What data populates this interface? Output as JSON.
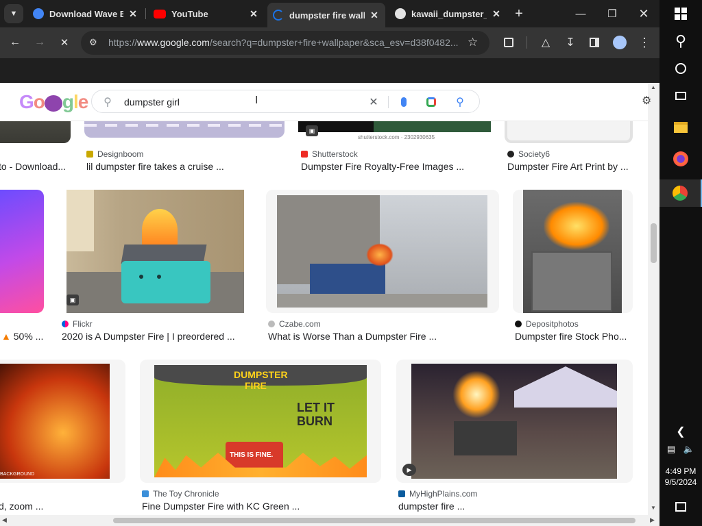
{
  "tabs": [
    {
      "label": "Download Wave Ex",
      "favicon_color": "#4285f4"
    },
    {
      "label": "YouTube",
      "favicon_color": "#ff0000"
    },
    {
      "label": "dumpster fire wallp",
      "favicon_color": "#1a73e8",
      "active": true
    },
    {
      "label": "kawaii_dumpster_fi",
      "favicon_color": "#e3e3e3"
    }
  ],
  "new_tab_label": "+",
  "address_bar": {
    "scheme": "https://",
    "host": "www.google.com",
    "path": "/search?q=dumpster+fire+wallpaper&sca_esv=d38f0482..."
  },
  "search": {
    "query": "dumpster girl",
    "logo": "Google"
  },
  "results": {
    "row1": [
      {
        "source": "",
        "title": "to - Download..."
      },
      {
        "source": "Designboom",
        "title": "lil dumpster fire takes a cruise ..."
      },
      {
        "source": "Shutterstock",
        "title": "Dumpster Fire Royalty-Free Images ...",
        "caption": "shutterstock.com · 2302930635"
      },
      {
        "source": "Society6",
        "title": "Dumpster Fire Art Print by ..."
      }
    ],
    "row2": [
      {
        "source": "",
        "title": "50% ..."
      },
      {
        "source": "Flickr",
        "title": "2020 is A Dumpster Fire | I preordered ..."
      },
      {
        "source": "Czabe.com",
        "title": "What is Worse Than a Dumpster Fire ..."
      },
      {
        "source": "Depositphotos",
        "title": "Dumpster fire Stock Pho..."
      }
    ],
    "row3": [
      {
        "source": "",
        "title": "d, zoom ...",
        "caption": "BACKGROUND"
      },
      {
        "source": "The Toy Chronicle",
        "title": "Fine Dumpster Fire with KC Green ...",
        "poster_top": "DUMPSTER",
        "poster_mid": "FIRE",
        "poster_right": "LET IT BURN",
        "poster_bin": "THIS IS FINE."
      },
      {
        "source": "MyHighPlains.com",
        "title": "dumpster fire ..."
      }
    ]
  },
  "taskbar": {
    "time": "4:49 PM",
    "date": "9/5/2024"
  },
  "colors": {
    "accent": "#1a73e8",
    "tabbar_bg": "#1f1f1f",
    "toolbar_bg": "#353535"
  }
}
